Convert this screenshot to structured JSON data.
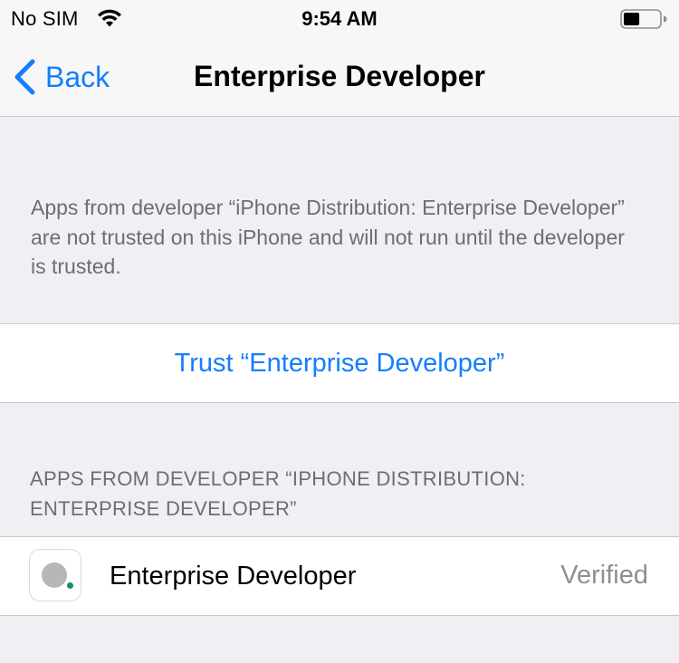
{
  "status_bar": {
    "carrier": "No SIM",
    "time": "9:54 AM",
    "wifi_icon": "wifi-icon",
    "battery_icon": "battery-icon",
    "battery_level": 0.45
  },
  "nav": {
    "back_label": "Back",
    "title": "Enterprise Developer"
  },
  "explanation": "Apps from developer “iPhone Distribution: Enterprise Developer” are not trusted on this iPhone and will not run until the developer is trusted.",
  "trust": {
    "label": "Trust “Enterprise Developer”"
  },
  "apps_section": {
    "header": "APPS FROM DEVELOPER “IPHONE DISTRIBUTION: ENTERPRISE DEVELOPER”",
    "items": [
      {
        "name": "Enterprise Developer",
        "status": "Verified",
        "icon": "app-icon"
      }
    ]
  },
  "colors": {
    "accent": "#147efb",
    "background": "#efeff4",
    "secondary_text": "#6d6d72",
    "separator": "#c8c7cc"
  }
}
